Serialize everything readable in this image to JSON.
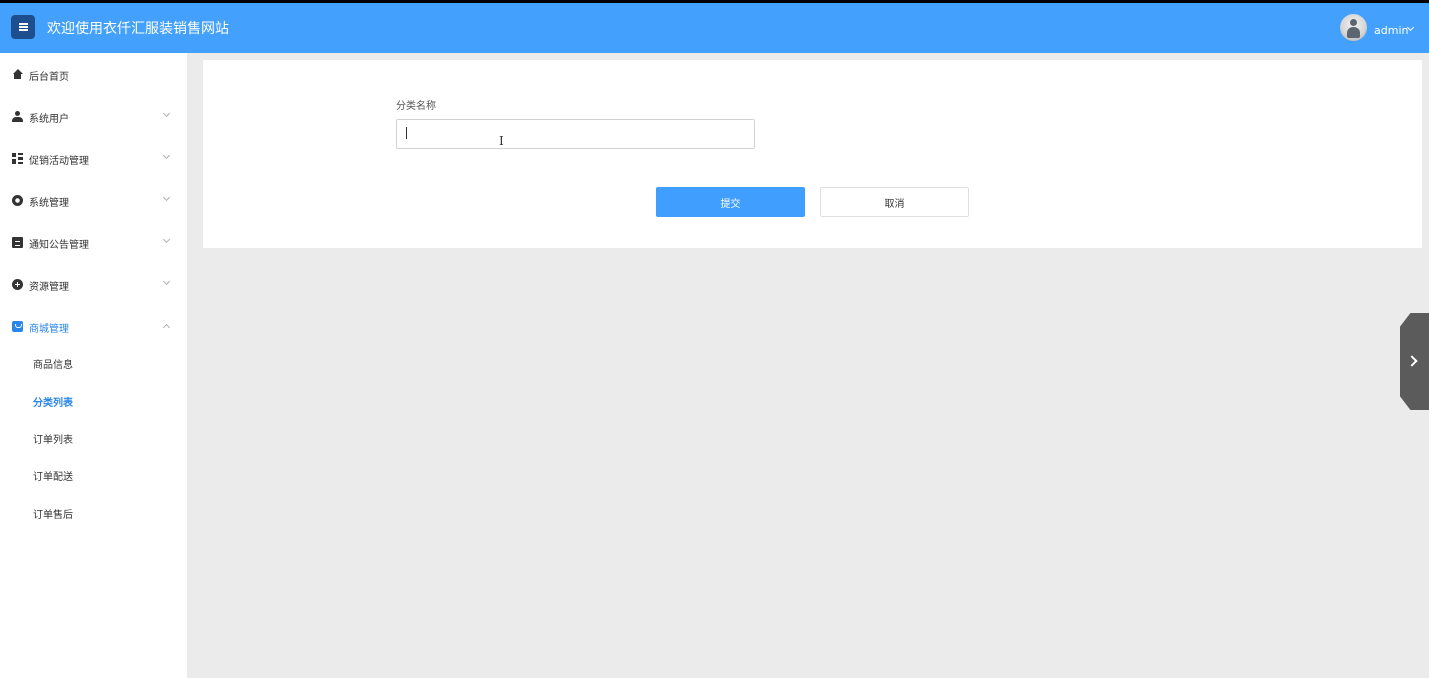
{
  "header": {
    "site_title": "欢迎使用衣仟汇服装销售网站",
    "menu_toggle_icon": "hamburger-icon",
    "user_name": "admin",
    "user_caret_icon": "chevron-down-icon"
  },
  "sidebar": {
    "items": [
      {
        "label": "后台首页",
        "icon": "home-icon",
        "expandable": false
      },
      {
        "label": "系统用户",
        "icon": "user-icon",
        "expandable": true
      },
      {
        "label": "促销活动管理",
        "icon": "dashboard-icon",
        "expandable": true
      },
      {
        "label": "系统管理",
        "icon": "gear-icon",
        "expandable": true
      },
      {
        "label": "通知公告管理",
        "icon": "document-icon",
        "expandable": true
      },
      {
        "label": "资源管理",
        "icon": "plus-circle-icon",
        "expandable": true
      },
      {
        "label": "商城管理",
        "icon": "shop-icon",
        "expandable": true,
        "expanded": true,
        "active": true
      }
    ],
    "subitems": [
      {
        "label": "商品信息"
      },
      {
        "label": "分类列表",
        "active": true
      },
      {
        "label": "订单列表"
      },
      {
        "label": "订单配送"
      },
      {
        "label": "订单售后"
      }
    ]
  },
  "form": {
    "category_name_label": "分类名称",
    "category_name_value": "",
    "submit_label": "提交",
    "cancel_label": "取消"
  },
  "colors": {
    "header_bg": "#44a0fd",
    "accent": "#409eff",
    "active_text": "#2a86e8",
    "content_bg": "#ebebeb"
  }
}
